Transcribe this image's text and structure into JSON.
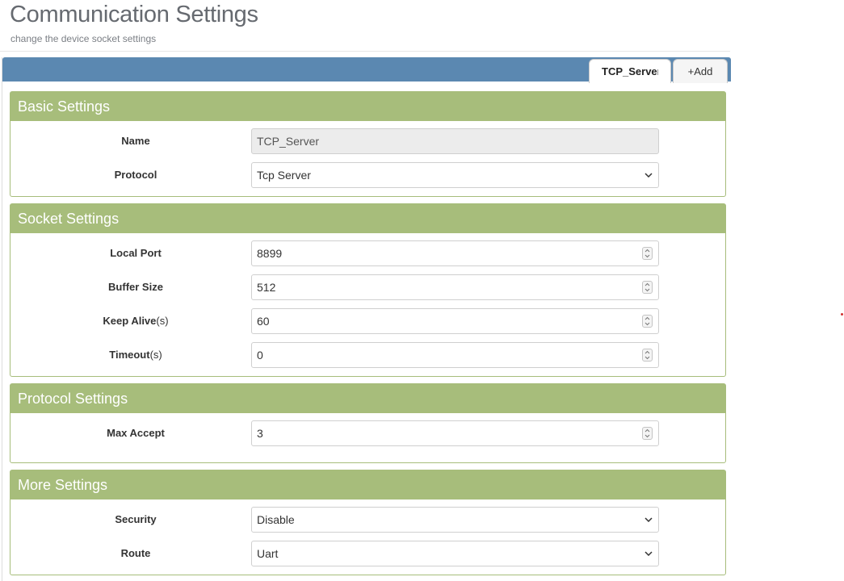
{
  "header": {
    "title": "Communication Settings",
    "subtitle": "change the device socket settings"
  },
  "tabs": [
    {
      "label": "TCP_Server",
      "active": true
    },
    {
      "label": "+Add",
      "active": false
    }
  ],
  "sections": {
    "basic": {
      "title": "Basic Settings",
      "name_label": "Name",
      "name_value": "TCP_Server",
      "protocol_label": "Protocol",
      "protocol_value": "Tcp Server"
    },
    "socket": {
      "title": "Socket Settings",
      "local_port_label": "Local Port",
      "local_port_value": "8899",
      "buffer_size_label": "Buffer Size",
      "buffer_size_value": "512",
      "keep_alive_label": "Keep Alive",
      "keep_alive_unit": "(s)",
      "keep_alive_value": "60",
      "timeout_label": "Timeout",
      "timeout_unit": "(s)",
      "timeout_value": "0"
    },
    "protocol": {
      "title": "Protocol Settings",
      "max_accept_label": "Max Accept",
      "max_accept_value": "3"
    },
    "more": {
      "title": "More Settings",
      "security_label": "Security",
      "security_value": "Disable",
      "route_label": "Route",
      "route_value": "Uart"
    }
  },
  "colors": {
    "tabbar": "#5b88b1",
    "section_header": "#a7bd7b"
  },
  "icons": {
    "select": "chevron-down-icon",
    "number": "spinner-icon"
  }
}
